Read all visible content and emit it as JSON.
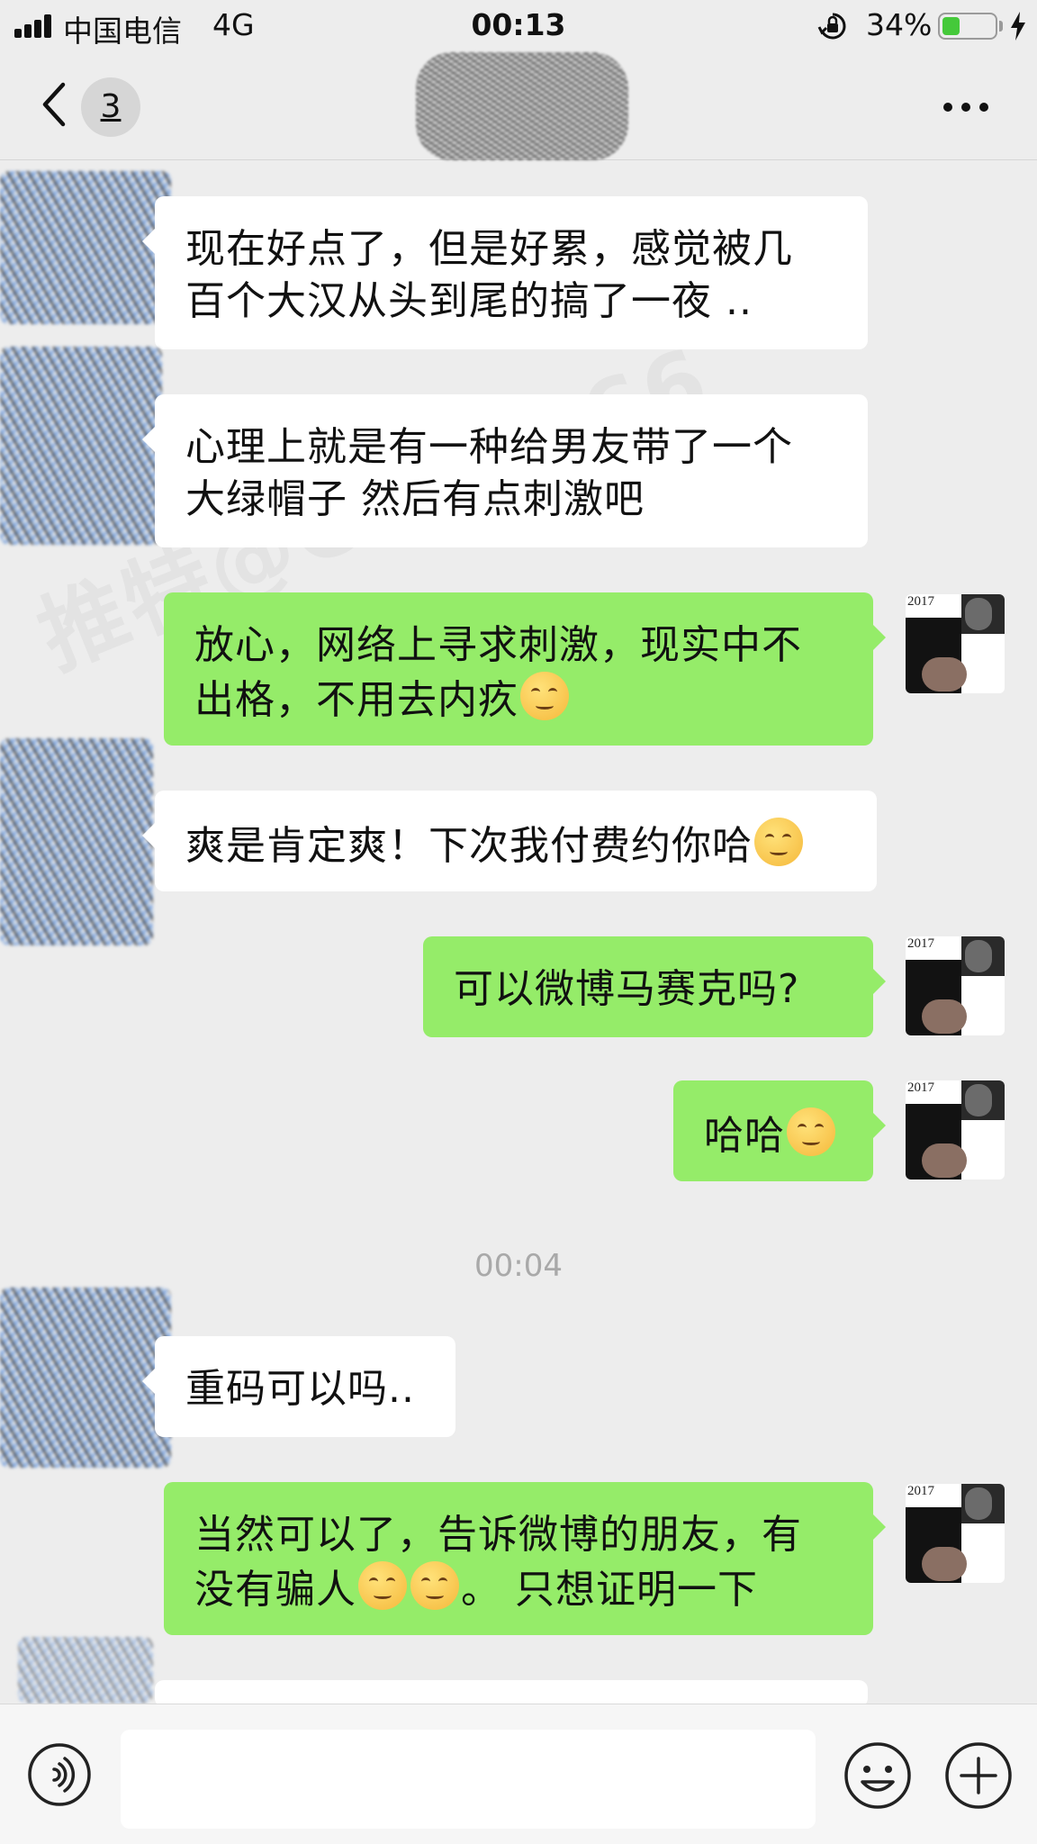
{
  "status_bar": {
    "carrier": "中国电信",
    "network": "4G",
    "time": "00:13",
    "battery_percent_text": "34%",
    "battery_level": 0.34,
    "battery_color": "#45c93a"
  },
  "nav": {
    "unread_count": "3",
    "back_icon": "chevron-left-icon",
    "more_icon": "ellipsis-icon"
  },
  "watermark": "推特@CPJDR66",
  "messages": [
    {
      "side": "in",
      "text": "现在好点了，但是好累，感觉被几",
      "text2": "百个大汉从头到尾的搞了一夜 .."
    },
    {
      "side": "in",
      "text": "心理上就是有一种给男友带了一个",
      "text2": "大绿帽子 然后有点刺激吧"
    },
    {
      "side": "out",
      "text": "放心，网络上寻求刺激，现实中不",
      "text2": "出格，不用去内疚",
      "emoji": "blushing-smile-emoji"
    },
    {
      "side": "in",
      "text": "爽是肯定爽！下次我付费约你哈",
      "emoji": "smirk-emoji"
    },
    {
      "side": "out",
      "text": "可以微博马赛克吗?"
    },
    {
      "side": "out",
      "text": "哈哈",
      "emoji": "laughing-tears-emoji"
    },
    {
      "side": "in",
      "text": "重码可以吗.."
    },
    {
      "side": "out",
      "text": "当然可以了，告诉微博的朋友，有",
      "text2a": "没有骗人",
      "text2b": "。 只想证明一下",
      "emoji": "smirk-emoji"
    }
  ],
  "timestamp": "00:04",
  "my_avatar": {
    "year_label": "2017"
  },
  "input_bar": {
    "voice_icon": "voice-icon",
    "emoji_icon": "emoji-icon",
    "plus_icon": "plus-icon",
    "input_value": ""
  },
  "colors": {
    "background": "#ededed",
    "incoming_bubble": "#ffffff",
    "outgoing_bubble": "#95ec69"
  }
}
